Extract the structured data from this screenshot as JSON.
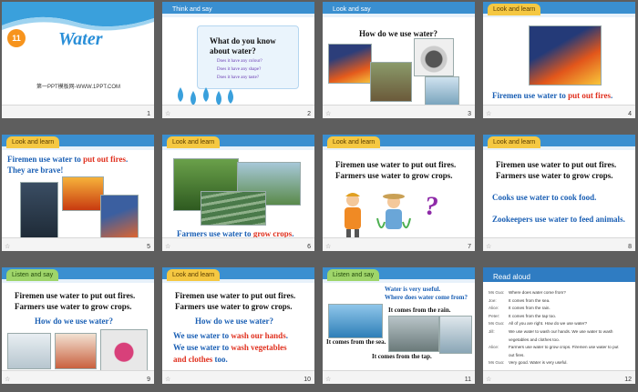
{
  "colors": {
    "accent": "#3a8fd0",
    "highlight": "#e0301e",
    "blueText": "#1a5fb4"
  },
  "slides": [
    {
      "num": "1",
      "badge": "11",
      "title": "Water",
      "footer": "第一PPT模板网-WWW.1PPT.COM"
    },
    {
      "num": "2",
      "tab": "Think and say",
      "heading1": "What do you know",
      "heading2": "about water?",
      "q1": "Does it have any colour?",
      "q2": "Does it have any shape?",
      "q3": "Does it have any taste?"
    },
    {
      "num": "3",
      "tab": "Look and say",
      "heading": "How do we use water?"
    },
    {
      "num": "4",
      "tab": "Look and learn",
      "s_pre": "Firemen use water to ",
      "s_red": "put out fires",
      "s_post": "."
    },
    {
      "num": "5",
      "tab": "Look and learn",
      "s_pre": "Firemen use water to ",
      "s_red": "put out fires",
      "s_post": ".",
      "line2": "They are brave!"
    },
    {
      "num": "6",
      "tab": "Look and learn",
      "s_pre": "Farmers use water to ",
      "s_red": "grow crops",
      "s_post": "."
    },
    {
      "num": "7",
      "tab": "Look and learn",
      "l1": "Firemen use water to put out fires.",
      "l2": "Farmers use water to grow crops.",
      "qmark": "?"
    },
    {
      "num": "8",
      "tab": "Look and learn",
      "l1": "Firemen use water to put out fires.",
      "l2": "Farmers use water to grow crops.",
      "l3": "Cooks use water to cook food.",
      "l4": "Zookeepers use water to feed animals."
    },
    {
      "num": "9",
      "tab": "Listen and say",
      "l1": "Firemen use water to put out fires.",
      "l2": "Farmers use water to grow crops.",
      "q": "How do we use water?"
    },
    {
      "num": "10",
      "tab": "Look and learn",
      "l1": "Firemen use water to put out fires.",
      "l2": "Farmers use water to grow crops.",
      "q": "How do we use water?",
      "a1_pre": "We use water to ",
      "a1_red": "wash our hands",
      "a1_post": ".",
      "a2_pre": "We use water to ",
      "a2_red": "wash vegetables",
      "a2_line2": "and clothes",
      "a2_post": " too."
    },
    {
      "num": "11",
      "tab": "Listen and say",
      "top1": "Water is very useful.",
      "top2": "Where does water come from?",
      "rain": "It comes from the rain.",
      "sea": "It comes from the sea.",
      "tap": "It comes from the tap."
    },
    {
      "num": "12",
      "tab": "Read aloud",
      "dialogue": [
        {
          "sp": "Ms Guo:",
          "tx": "Where does water come from?"
        },
        {
          "sp": "Joe:",
          "tx": "It comes from the sea."
        },
        {
          "sp": "Alice:",
          "tx": "It comes from the rain."
        },
        {
          "sp": "Peter:",
          "tx": "It comes from the tap too."
        },
        {
          "sp": "Ms Guo:",
          "tx": "All of you are right. How do we use water?"
        },
        {
          "sp": "Jill:",
          "tx": "We use water to wash our hands. We use water to wash"
        },
        {
          "sp": "",
          "tx": "vegetables and clothes too."
        },
        {
          "sp": "Alice:",
          "tx": "Farmers use water to grow crops. Firemen use water to put"
        },
        {
          "sp": "",
          "tx": "out fires."
        },
        {
          "sp": "Ms Guo:",
          "tx": "Very good. Water is very useful."
        }
      ]
    }
  ]
}
